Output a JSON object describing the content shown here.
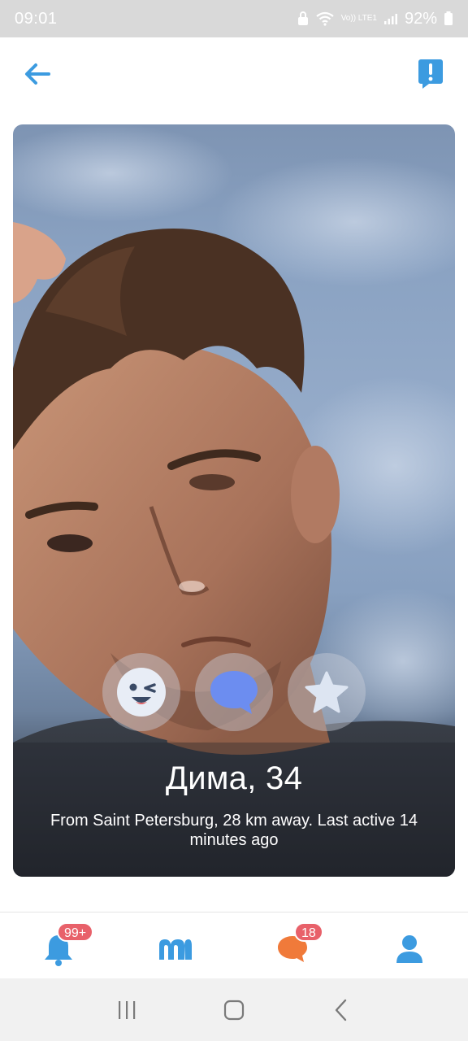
{
  "status_bar": {
    "time": "09:01",
    "network": "Vo)) LTE1",
    "battery": "92%"
  },
  "header": {
    "back_icon": "arrow-left-icon",
    "report_icon": "exclamation-bubble-icon",
    "accent_color": "#3c9be0"
  },
  "profile": {
    "name_age": "Дима, 34",
    "details": "From Saint Petersburg, 28 km away. Last active 14 minutes ago",
    "actions": [
      {
        "icon": "wink-face-icon"
      },
      {
        "icon": "chat-bubble-icon"
      },
      {
        "icon": "star-icon"
      }
    ]
  },
  "bottom_nav": {
    "items": [
      {
        "icon": "bell-icon",
        "badge": "99+"
      },
      {
        "icon": "m-logo-icon",
        "badge": ""
      },
      {
        "icon": "chat-icon",
        "badge": "18"
      },
      {
        "icon": "profile-icon",
        "badge": ""
      }
    ],
    "badge_color": "#e8616a"
  },
  "system_nav": {
    "items": [
      "recents",
      "home",
      "back"
    ]
  }
}
